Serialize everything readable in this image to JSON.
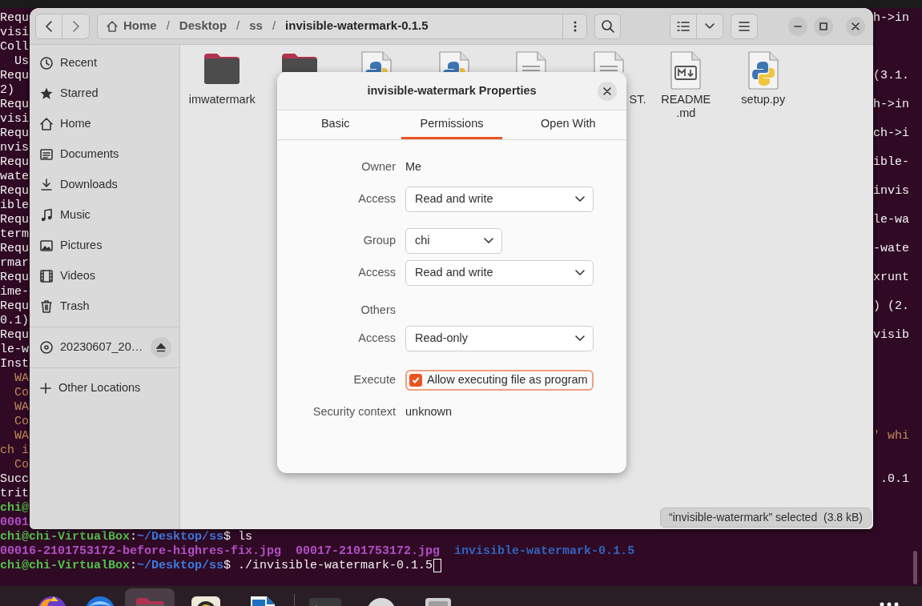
{
  "terminal": {
    "lines": [
      {
        "segments": [
          {
            "text": "Requ",
            "kind": "plain"
          }
        ],
        "right": {
          "text": "h->in",
          "kind": "plain"
        }
      },
      {
        "segments": [
          {
            "text": "visi",
            "kind": "plain"
          }
        ]
      },
      {
        "segments": [
          {
            "text": "Coll",
            "kind": "plain"
          }
        ]
      },
      {
        "indent": true,
        "segments": [
          {
            "text": "Us",
            "kind": "plain"
          }
        ]
      },
      {
        "segments": [
          {
            "text": "Requ",
            "kind": "plain"
          }
        ],
        "right": {
          "text": "(3.1.",
          "kind": "plain"
        }
      },
      {
        "segments": [
          {
            "text": "2)",
            "kind": "plain"
          }
        ]
      },
      {
        "segments": [
          {
            "text": "Requ",
            "kind": "plain"
          }
        ],
        "right": {
          "text": "h->in",
          "kind": "plain"
        }
      },
      {
        "segments": [
          {
            "text": "visi",
            "kind": "plain"
          }
        ]
      },
      {
        "segments": [
          {
            "text": "Requ",
            "kind": "plain"
          }
        ],
        "right": {
          "text": "ch->i",
          "kind": "plain"
        }
      },
      {
        "segments": [
          {
            "text": "nvis",
            "kind": "plain"
          }
        ]
      },
      {
        "segments": [
          {
            "text": "Requ",
            "kind": "plain"
          }
        ],
        "right": {
          "text": "ible-",
          "kind": "plain"
        }
      },
      {
        "segments": [
          {
            "text": "wate",
            "kind": "plain"
          }
        ]
      },
      {
        "segments": [
          {
            "text": "Requ",
            "kind": "plain"
          }
        ],
        "right": {
          "text": "invis",
          "kind": "plain"
        }
      },
      {
        "segments": [
          {
            "text": "ible",
            "kind": "plain"
          }
        ]
      },
      {
        "segments": [
          {
            "text": "Requ",
            "kind": "plain"
          }
        ],
        "right": {
          "text": "le-wa",
          "kind": "plain"
        }
      },
      {
        "segments": [
          {
            "text": "term",
            "kind": "plain"
          }
        ]
      },
      {
        "segments": [
          {
            "text": "Requ",
            "kind": "plain"
          }
        ],
        "right": {
          "text": "-wate",
          "kind": "plain"
        }
      },
      {
        "segments": [
          {
            "text": "rmar",
            "kind": "plain"
          }
        ]
      },
      {
        "segments": [
          {
            "text": "Requ",
            "kind": "plain"
          }
        ],
        "right": {
          "text": "xrunt",
          "kind": "plain"
        }
      },
      {
        "segments": [
          {
            "text": "ime-",
            "kind": "plain"
          }
        ]
      },
      {
        "segments": [
          {
            "text": "Requ",
            "kind": "plain"
          }
        ],
        "right": {
          "text": ") (2.",
          "kind": "plain"
        }
      },
      {
        "segments": [
          {
            "text": "0.1)",
            "kind": "plain"
          }
        ]
      },
      {
        "segments": [
          {
            "text": "Requ",
            "kind": "plain"
          }
        ],
        "right": {
          "text": "visib",
          "kind": "plain"
        }
      },
      {
        "segments": [
          {
            "text": "le-w",
            "kind": "plain"
          }
        ]
      },
      {
        "segments": [
          {
            "text": "Inst",
            "kind": "plain"
          }
        ]
      },
      {
        "indent": true,
        "segments": [
          {
            "text": "WA",
            "kind": "warning"
          }
        ]
      },
      {
        "indent": true,
        "segments": [
          {
            "text": "Co",
            "kind": "warning"
          }
        ]
      },
      {
        "indent": true,
        "segments": [
          {
            "text": "WA",
            "kind": "warning"
          }
        ]
      },
      {
        "indent": true,
        "segments": [
          {
            "text": "Co",
            "kind": "warning"
          }
        ]
      },
      {
        "indent": true,
        "segments": [
          {
            "text": "WA",
            "kind": "warning"
          }
        ],
        "right": {
          "text": "' whi",
          "kind": "warning"
        }
      },
      {
        "segments": [
          {
            "text": "ch i",
            "kind": "warning"
          }
        ]
      },
      {
        "indent": true,
        "segments": [
          {
            "text": "Co",
            "kind": "warning"
          }
        ]
      },
      {
        "segments": [
          {
            "text": "Succ",
            "kind": "plain"
          }
        ],
        "right": {
          "text": ".0.1",
          "kind": "plain"
        }
      },
      {
        "segments": [
          {
            "text": "trit",
            "kind": "plain"
          }
        ]
      },
      {
        "segments": [
          {
            "text": "chi@",
            "kind": "user"
          }
        ]
      },
      {
        "segments": [
          {
            "text": "0001",
            "kind": "image"
          }
        ]
      },
      {
        "segments": [
          {
            "text": "chi@chi-VirtualBox",
            "kind": "user"
          },
          {
            "text": ":",
            "kind": "plain"
          },
          {
            "text": "~/Desktop/ss",
            "kind": "path"
          },
          {
            "text": "$ ls",
            "kind": "plain"
          }
        ]
      },
      {
        "listing": true,
        "segments": [
          {
            "text": "00016-2101753172-before-highres-fix.jpg",
            "kind": "image"
          },
          {
            "text": "00017-2101753172.jpg",
            "kind": "image"
          },
          {
            "text": "invisible-watermark-0.1.5",
            "kind": "directory"
          }
        ]
      },
      {
        "cursor": true,
        "segments": [
          {
            "text": "chi@chi-VirtualBox",
            "kind": "user"
          },
          {
            "text": ":",
            "kind": "plain"
          },
          {
            "text": "~/Desktop/ss",
            "kind": "path"
          },
          {
            "text": "$ ./invisible-watermark-0.1.5",
            "kind": "plain"
          }
        ]
      }
    ]
  },
  "file_manager": {
    "path": [
      {
        "kind": "crumb",
        "text": "Home"
      },
      {
        "kind": "separator",
        "text": "/"
      },
      {
        "kind": "crumb",
        "text": "Desktop"
      },
      {
        "kind": "separator",
        "text": "/"
      },
      {
        "kind": "crumb",
        "text": "ss"
      },
      {
        "kind": "separator",
        "text": "/"
      },
      {
        "kind": "current",
        "text": "invisible-watermark-0.1.5"
      }
    ],
    "sidebar": {
      "items": [
        {
          "label": "Recent",
          "kind": "place"
        },
        {
          "label": "Starred",
          "kind": "place"
        },
        {
          "label": "Home",
          "kind": "place"
        },
        {
          "label": "Documents",
          "kind": "place"
        },
        {
          "label": "Downloads",
          "kind": "place"
        },
        {
          "label": "Music",
          "kind": "place"
        },
        {
          "label": "Pictures",
          "kind": "place"
        },
        {
          "label": "Videos",
          "kind": "place"
        },
        {
          "label": "Trash",
          "kind": "place"
        },
        {
          "label": "20230607_20…",
          "kind": "device"
        },
        {
          "label": "Other Locations",
          "kind": "other"
        }
      ]
    },
    "files": [
      {
        "kind": "folder",
        "label": "imwatermark"
      },
      {
        "kind": "folder"
      },
      {
        "kind": "python"
      },
      {
        "kind": "python"
      },
      {
        "kind": "text"
      },
      {
        "kind": "text",
        "label": "ST."
      },
      {
        "kind": "markdown",
        "label": "README.md"
      },
      {
        "kind": "python",
        "label": "setup.py"
      }
    ],
    "status": "“invisible-watermark” selected  (3.8 kB)"
  },
  "dialog": {
    "title": "invisible-watermark Properties",
    "tabs": [
      {
        "label": "Basic",
        "selected": false
      },
      {
        "label": "Permissions",
        "selected": true
      },
      {
        "label": "Open With",
        "selected": false
      }
    ],
    "rows": [
      {
        "kind": "text",
        "label": "Owner",
        "value": "Me"
      },
      {
        "kind": "select",
        "label": "Access",
        "value": "Read and write"
      },
      {
        "kind": "combo",
        "label": "Group",
        "value": "chi"
      },
      {
        "kind": "select",
        "label": "Access",
        "value": "Read and write"
      },
      {
        "kind": "heading",
        "label": "Others"
      },
      {
        "kind": "select",
        "label": "Access",
        "value": "Read-only"
      },
      {
        "kind": "checkbox",
        "label": "Execute",
        "value": "Allow executing file as program",
        "checked": true,
        "focused": true
      },
      {
        "kind": "text",
        "label": "Security context",
        "value": "unknown"
      }
    ]
  }
}
